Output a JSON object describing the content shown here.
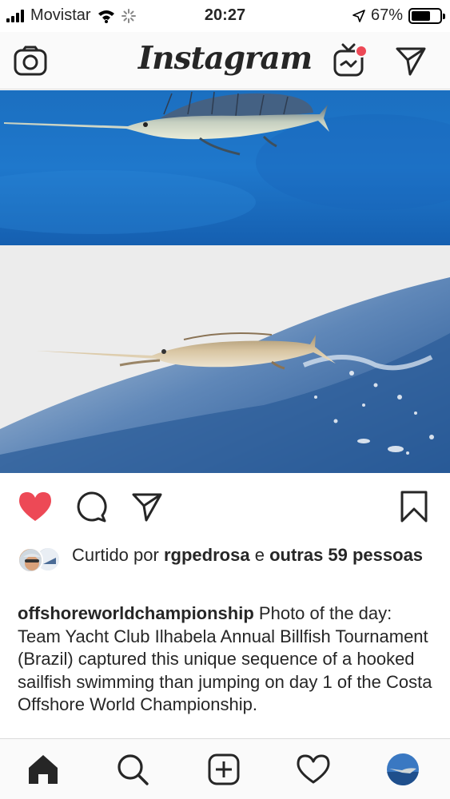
{
  "status_bar": {
    "carrier": "Movistar",
    "time": "20:27",
    "battery_text": "67%",
    "battery_level": 0.67
  },
  "header": {
    "logo_text": "Instagram",
    "camera_icon": "camera-icon",
    "igtv_icon": "igtv-icon",
    "direct_icon": "direct-message-icon",
    "notification_dot_color": "#ed4956"
  },
  "post": {
    "liked": true,
    "like_color": "#ed4956",
    "likes": {
      "prefix": "Curtido por",
      "user": "rgpedrosa",
      "conjunction": "e",
      "others": "outras 59 pessoas"
    },
    "caption": {
      "username": "offshoreworldchampionship",
      "text": "Photo of the day: Team Yacht Club Ilhabela Annual Billfish Tournament (Brazil) captured this unique sequence of a hooked sailfish swimming than jumping on day 1 of the Costa Offshore World Championship."
    }
  },
  "bottom_nav": {
    "items": [
      "home-icon",
      "search-icon",
      "new-post-icon",
      "activity-heart-icon",
      "profile-avatar"
    ]
  }
}
